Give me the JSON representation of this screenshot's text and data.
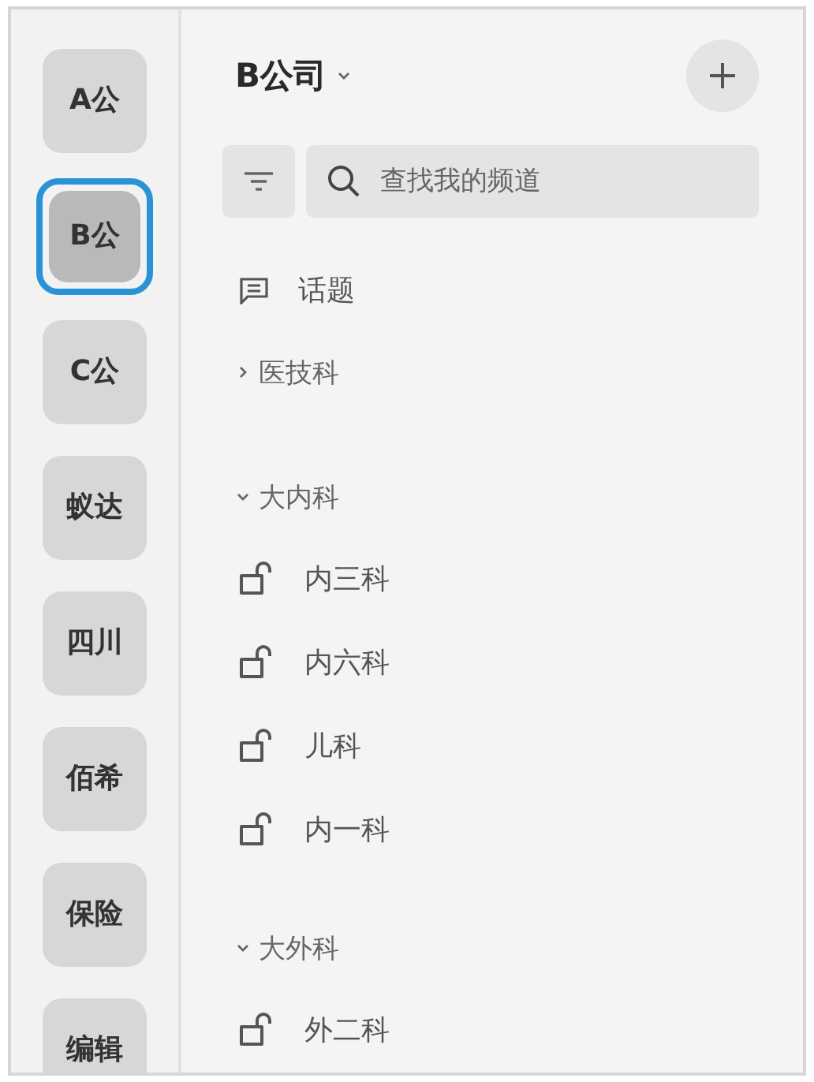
{
  "sidebar": {
    "items": [
      {
        "label": "A公",
        "selected": false
      },
      {
        "label": "B公",
        "selected": true
      },
      {
        "label": "C公",
        "selected": false
      },
      {
        "label": "蚁达",
        "selected": false
      },
      {
        "label": "四川",
        "selected": false
      },
      {
        "label": "佰希",
        "selected": false
      },
      {
        "label": "保险",
        "selected": false
      },
      {
        "label": "编辑",
        "selected": false
      }
    ]
  },
  "header": {
    "title": "B公司"
  },
  "search": {
    "placeholder": "查找我的频道"
  },
  "topic": {
    "label": "话题"
  },
  "groups": [
    {
      "label": "医技科",
      "expanded": false
    },
    {
      "label": "大内科",
      "expanded": true,
      "children": [
        {
          "label": "内三科"
        },
        {
          "label": "内六科"
        },
        {
          "label": "儿科"
        },
        {
          "label": "内一科"
        }
      ]
    },
    {
      "label": "大外科",
      "expanded": true,
      "children": [
        {
          "label": "外二科"
        }
      ]
    }
  ]
}
